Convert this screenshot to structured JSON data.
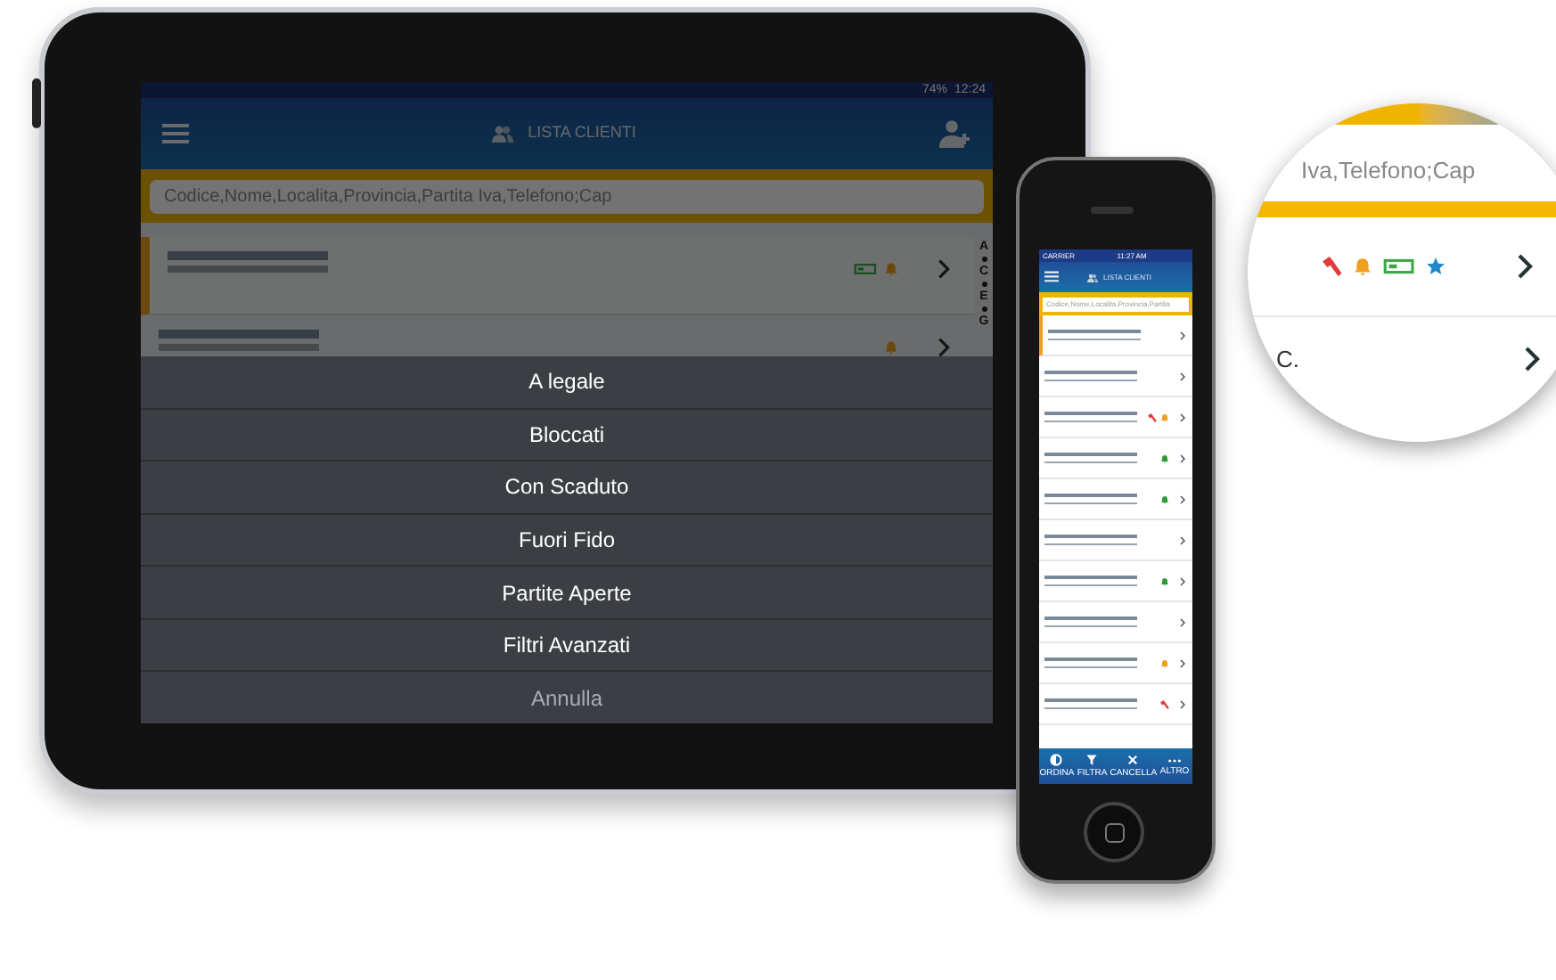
{
  "tablet": {
    "status_bar": {
      "battery": "74%",
      "time": "12:24"
    },
    "app_bar": {
      "title": "LISTA CLIENTI"
    },
    "search": {
      "placeholder": "Codice,Nome,Localita,Provincia,Partita Iva,Telefono;Cap"
    },
    "index_letters": [
      "A",
      "C",
      "E",
      "G"
    ],
    "rows": [
      {
        "highlighted": true,
        "icons": [
          {
            "kind": "battery"
          },
          {
            "kind": "bell"
          }
        ]
      },
      {
        "highlighted": false,
        "icons": [
          {
            "kind": "bell"
          }
        ]
      }
    ],
    "action_sheet": {
      "options": [
        "A legale",
        "Bloccati",
        "Con Scaduto",
        "Fuori Fido",
        "Partite Aperte",
        "Filtri Avanzati"
      ],
      "cancel": "Annulla"
    }
  },
  "phone": {
    "status_bar": {
      "carrier": "CARRIER",
      "time": "11:27 AM"
    },
    "app_bar": {
      "title": "LISTA CLIENTI"
    },
    "search": {
      "placeholder": "Codice,Nome,Localita,Provincia,Partita"
    },
    "rows": [
      {
        "highlighted": true,
        "icons": []
      },
      {
        "highlighted": false,
        "icons": []
      },
      {
        "highlighted": false,
        "icons": [
          {
            "kind": "hammer",
            "color": "#e03a3a"
          },
          {
            "kind": "bell",
            "color": "#f0a020"
          }
        ]
      },
      {
        "highlighted": false,
        "icons": [
          {
            "kind": "bell",
            "color": "#2e9a3a"
          }
        ]
      },
      {
        "highlighted": false,
        "icons": [
          {
            "kind": "bell",
            "color": "#2e9a3a"
          }
        ]
      },
      {
        "highlighted": false,
        "icons": []
      },
      {
        "highlighted": false,
        "icons": [
          {
            "kind": "bell",
            "color": "#2e9a3a"
          }
        ]
      },
      {
        "highlighted": false,
        "icons": []
      },
      {
        "highlighted": false,
        "icons": [
          {
            "kind": "bell",
            "color": "#f0a020"
          }
        ]
      },
      {
        "highlighted": false,
        "icons": [
          {
            "kind": "hammer",
            "color": "#e03a3a"
          }
        ]
      }
    ],
    "toolbar": [
      {
        "kind": "sort",
        "label": "ORDINA"
      },
      {
        "kind": "filter",
        "label": "FILTRA"
      },
      {
        "kind": "clear",
        "label": "CANCELLA"
      },
      {
        "kind": "more",
        "label": "ALTRO"
      }
    ]
  },
  "magnifier": {
    "search_text": "Iva,Telefono;Cap",
    "row_icons": [
      {
        "kind": "hammer",
        "color": "#e03a3a"
      },
      {
        "kind": "bell",
        "color": "#f0a020"
      },
      {
        "kind": "battery",
        "color": "#3aa845"
      },
      {
        "kind": "star",
        "color": "#1e88c8"
      }
    ],
    "next_row_text": "C."
  }
}
